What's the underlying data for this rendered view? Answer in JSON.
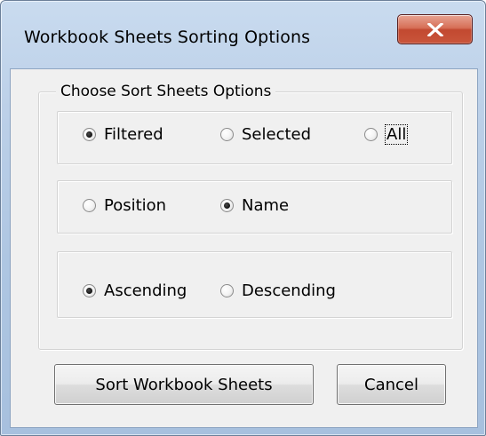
{
  "window": {
    "title": "Workbook Sheets Sorting Options"
  },
  "icons": {
    "close": "close-x-icon"
  },
  "group": {
    "label": "Choose Sort Sheets Options"
  },
  "scope_options": [
    {
      "label": "Filtered",
      "checked": true
    },
    {
      "label": "Selected",
      "checked": false
    },
    {
      "label": "All",
      "checked": false,
      "focused": true
    }
  ],
  "key_options": [
    {
      "label": "Position",
      "checked": false
    },
    {
      "label": "Name",
      "checked": true
    }
  ],
  "order_options": [
    {
      "label": "Ascending",
      "checked": true
    },
    {
      "label": "Descending",
      "checked": false
    }
  ],
  "buttons": {
    "sort_label": "Sort Workbook Sheets",
    "cancel_label": "Cancel"
  },
  "colors": {
    "close_button": "#c94b30",
    "title_bar": "#bcd0e8",
    "client_background": "#f0f0f0"
  }
}
